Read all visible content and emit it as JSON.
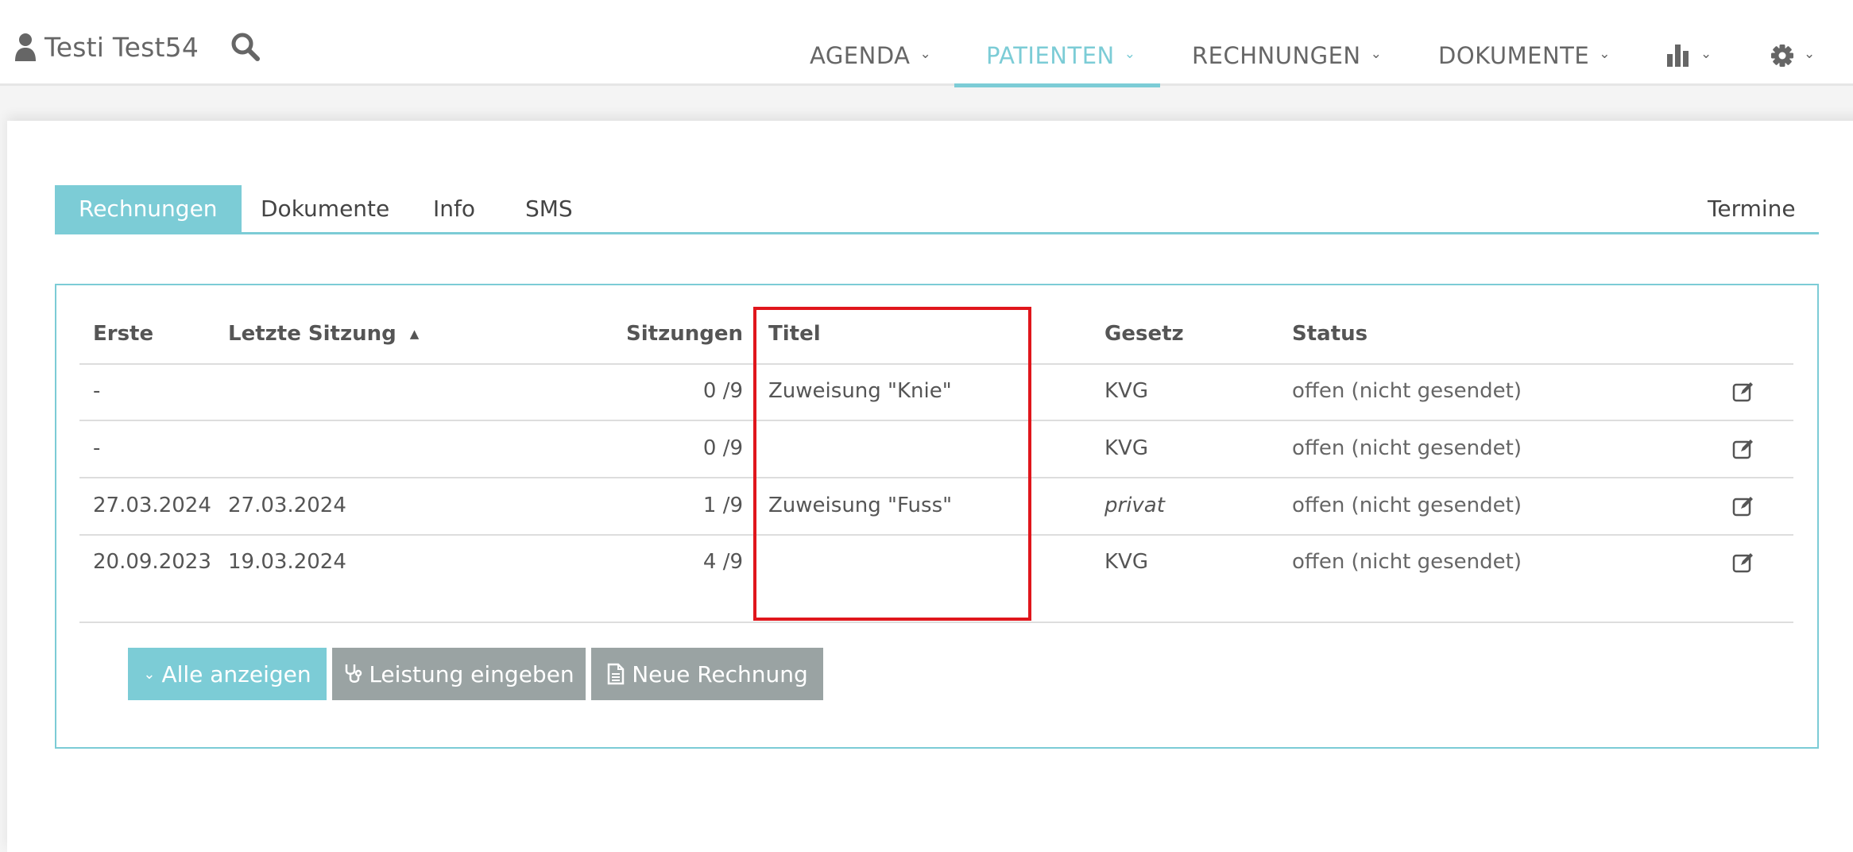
{
  "header": {
    "user_name": "Testi Test54",
    "nav": [
      {
        "label": "AGENDA"
      },
      {
        "label": "PATIENTEN",
        "active": true
      },
      {
        "label": "RECHNUNGEN"
      },
      {
        "label": "DOKUMENTE"
      }
    ],
    "chevron": "⌄",
    "accent_color": "#7cccd6"
  },
  "tabs": [
    {
      "label": "Rechnungen",
      "active": true
    },
    {
      "label": "Dokumente"
    },
    {
      "label": "Info"
    },
    {
      "label": "SMS"
    },
    {
      "label": "Termine"
    }
  ],
  "table": {
    "columns": [
      "Erste",
      "Letzte Sitzung",
      "Sitzungen",
      "Titel",
      "Gesetz",
      "Status"
    ],
    "sort_indicator": "▲",
    "rows": [
      {
        "erste": "-",
        "letzte": "",
        "sitzungen": "0 /9",
        "titel": "Zuweisung \"Knie\"",
        "gesetz": "KVG",
        "status": "offen (nicht gesendet)"
      },
      {
        "erste": "-",
        "letzte": "",
        "sitzungen": "0 /9",
        "titel": "",
        "gesetz": "KVG",
        "status": "offen (nicht gesendet)"
      },
      {
        "erste": "27.03.2024",
        "letzte": "27.03.2024",
        "sitzungen": "1 /9",
        "titel": "Zuweisung \"Fuss\"",
        "gesetz": "privat",
        "status": "offen (nicht gesendet)"
      },
      {
        "erste": "20.09.2023",
        "letzte": "19.03.2024",
        "sitzungen": "4 /9",
        "titel": "",
        "gesetz": "KVG",
        "status": "offen (nicht gesendet)"
      }
    ]
  },
  "buttons": {
    "show_all": "Alle anzeigen",
    "enter_service": "Leistung eingeben",
    "new_invoice": "Neue Rechnung"
  },
  "colors": {
    "highlight": "#e0161c",
    "button_grey": "#9aa3a3"
  }
}
